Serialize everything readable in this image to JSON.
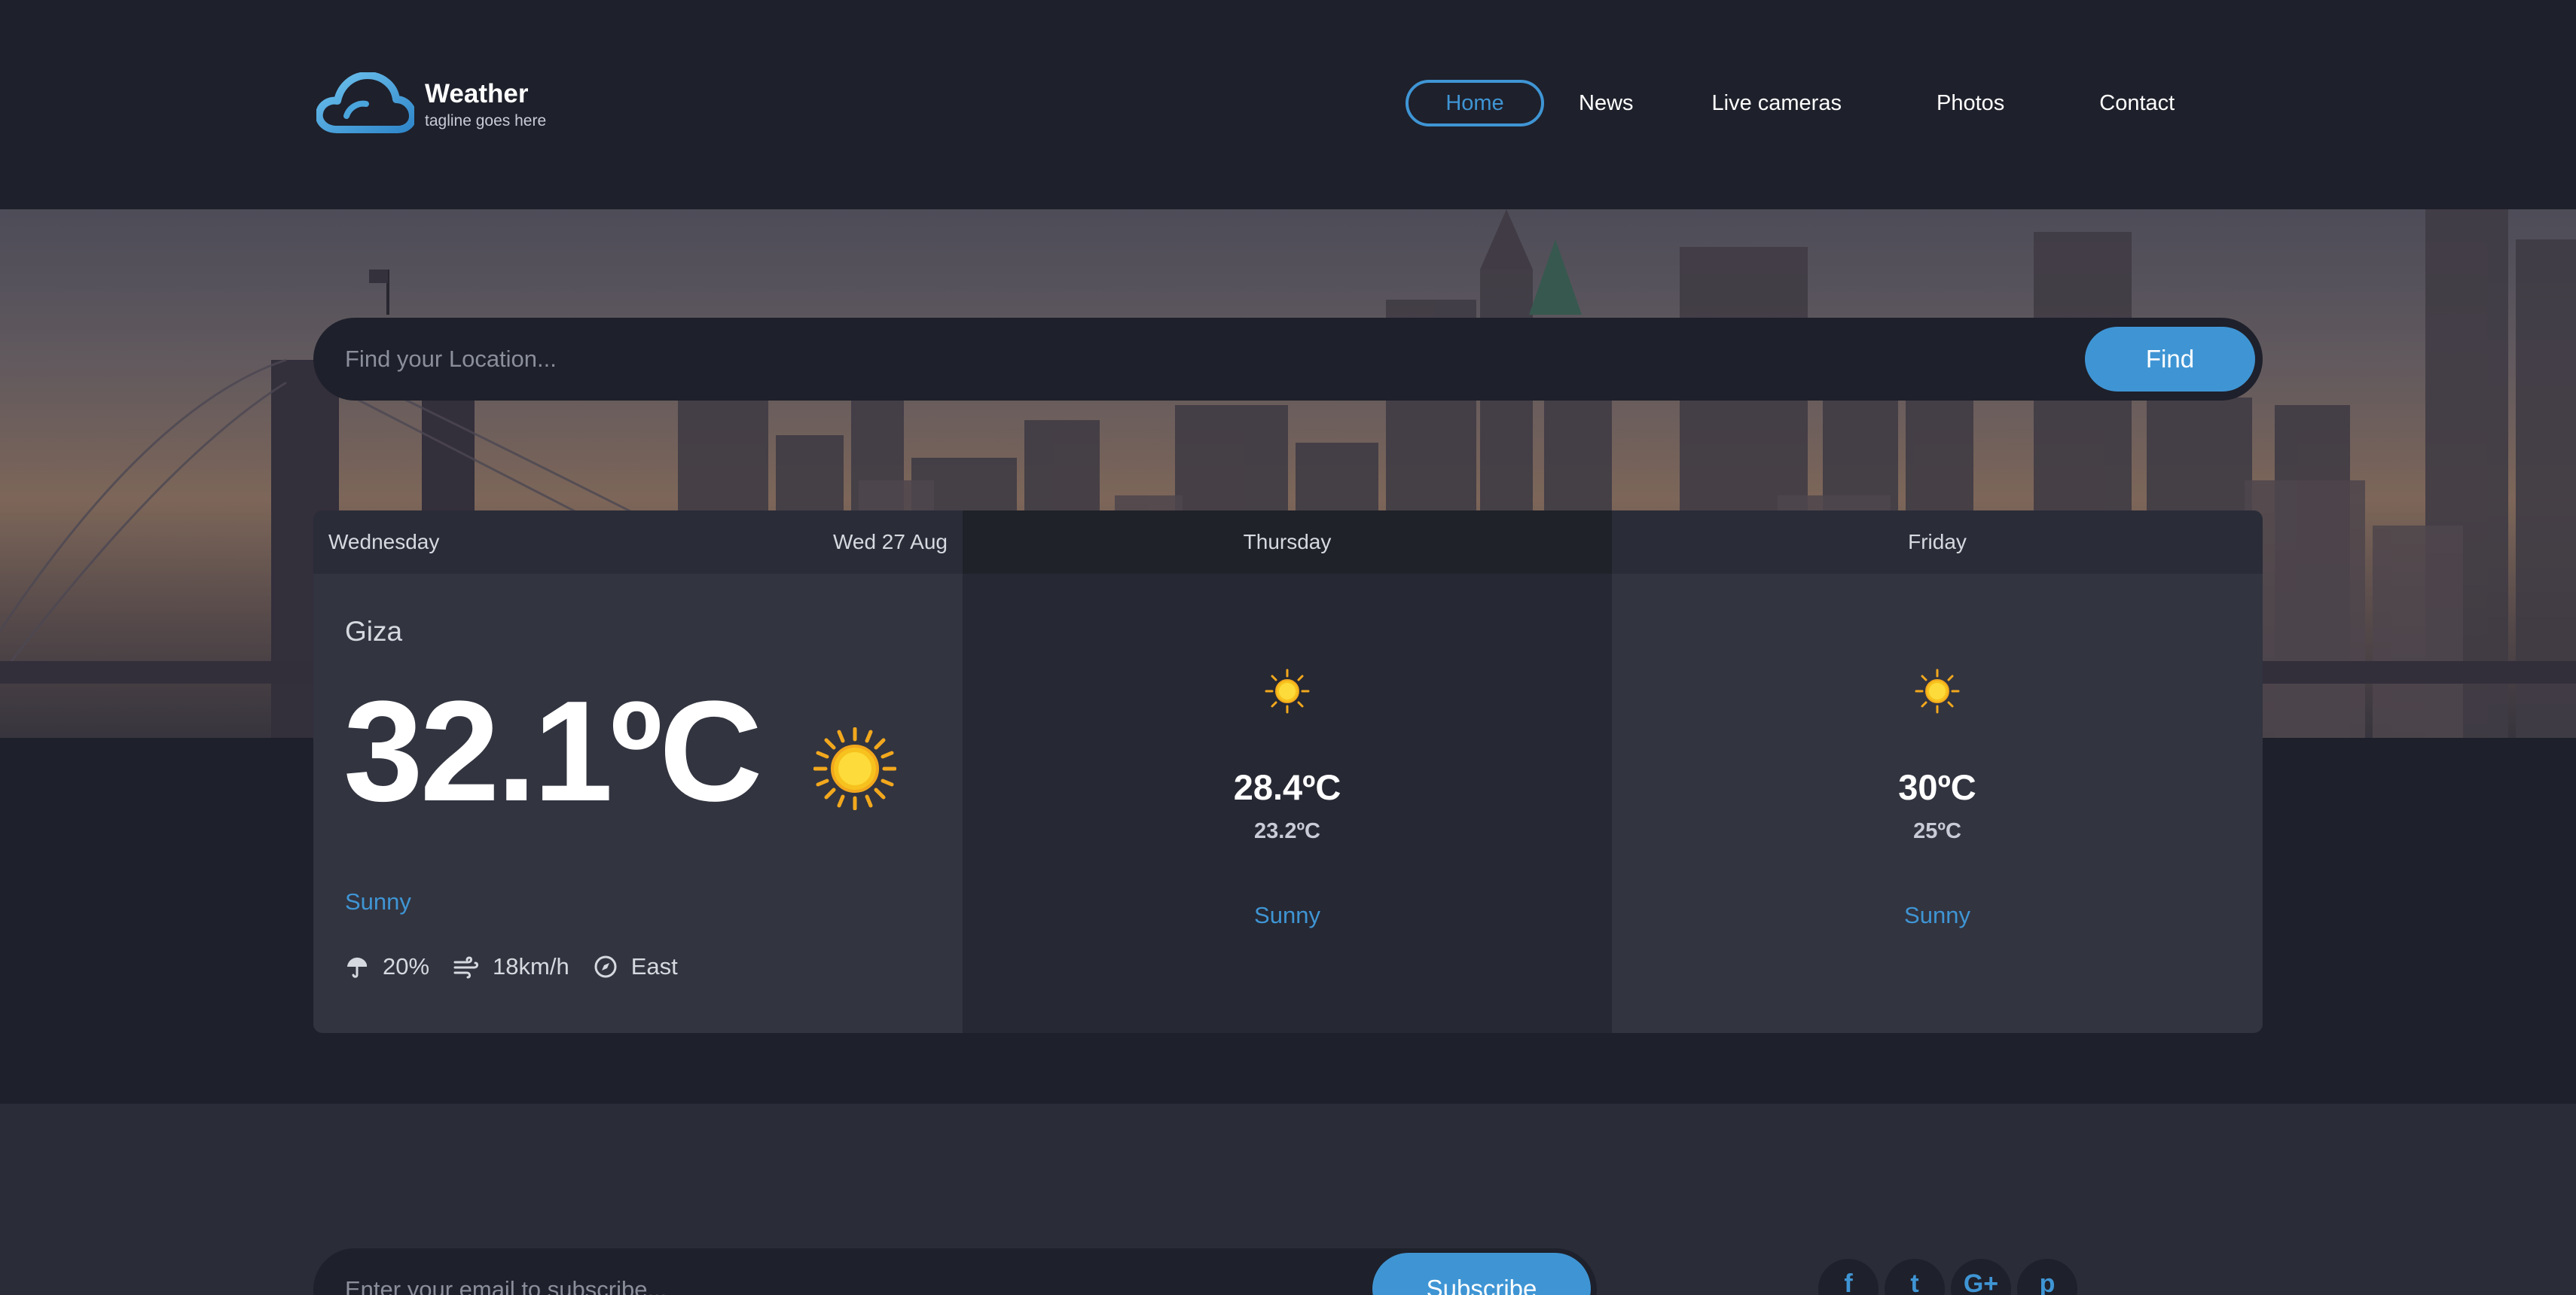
{
  "brand": {
    "title": "Weather",
    "tagline": "tagline goes here",
    "logo_icon": "cloud-icon"
  },
  "nav": {
    "items": [
      {
        "label": "Home",
        "active": true
      },
      {
        "label": "News"
      },
      {
        "label": "Live cameras"
      },
      {
        "label": "Photos"
      },
      {
        "label": "Contact"
      }
    ]
  },
  "search": {
    "placeholder": "Find your Location...",
    "button_label": "Find"
  },
  "today": {
    "day": "Wednesday",
    "date": "Wed 27 Aug",
    "city": "Giza",
    "temperature": "32.1ºC",
    "icon": "sun-icon",
    "condition": "Sunny",
    "humidity": "20%",
    "wind_speed": "18km/h",
    "wind_direction": "East"
  },
  "forecast": [
    {
      "day": "Thursday",
      "icon": "sun-icon",
      "max": "28.4ºC",
      "min": "23.2ºC",
      "condition": "Sunny"
    },
    {
      "day": "Friday",
      "icon": "sun-icon",
      "max": "30ºC",
      "min": "25ºC",
      "condition": "Sunny"
    }
  ],
  "footer": {
    "subscribe_placeholder": "Enter your email to subscribe...",
    "subscribe_button": "Subscribe",
    "social": [
      {
        "icon": "facebook-icon",
        "glyph": "f"
      },
      {
        "icon": "twitter-icon",
        "glyph": "t"
      },
      {
        "icon": "google-plus-icon",
        "glyph": "G+"
      },
      {
        "icon": "pinterest-icon",
        "glyph": "p"
      }
    ]
  },
  "colors": {
    "accent": "#3f95d4",
    "background": "#1e202b",
    "card": "#323440",
    "card_alt": "#262833"
  }
}
